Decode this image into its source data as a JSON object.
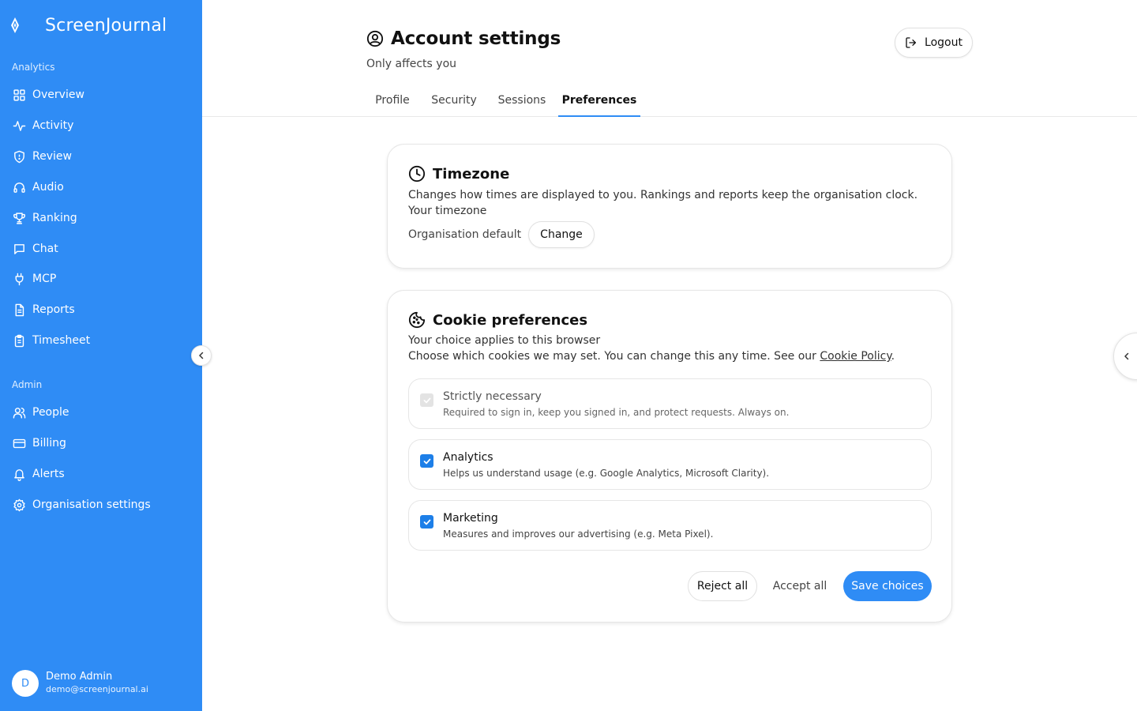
{
  "brand": {
    "name": "ScreenJournal"
  },
  "sidebar": {
    "analytics_label": "Analytics",
    "analytics_items": [
      {
        "label": "Overview",
        "icon": "grid-icon"
      },
      {
        "label": "Activity",
        "icon": "activity-icon"
      },
      {
        "label": "Review",
        "icon": "shield-icon"
      },
      {
        "label": "Audio",
        "icon": "headphones-icon"
      },
      {
        "label": "Ranking",
        "icon": "trophy-icon"
      },
      {
        "label": "Chat",
        "icon": "chat-icon"
      },
      {
        "label": "MCP",
        "icon": "plug-icon"
      },
      {
        "label": "Reports",
        "icon": "document-icon"
      },
      {
        "label": "Timesheet",
        "icon": "clipboard-icon"
      }
    ],
    "admin_label": "Admin",
    "admin_items": [
      {
        "label": "People",
        "icon": "people-icon"
      },
      {
        "label": "Billing",
        "icon": "credit-card-icon"
      },
      {
        "label": "Alerts",
        "icon": "bell-icon"
      },
      {
        "label": "Organisation settings",
        "icon": "gear-icon"
      }
    ],
    "user": {
      "initial": "D",
      "name": "Demo Admin",
      "email": "demo@screenjournal.ai"
    }
  },
  "header": {
    "title": "Account settings",
    "subtitle": "Only affects you",
    "logout_label": "Logout"
  },
  "tabs": [
    {
      "label": "Profile",
      "active": false
    },
    {
      "label": "Security",
      "active": false
    },
    {
      "label": "Sessions",
      "active": false
    },
    {
      "label": "Preferences",
      "active": true
    }
  ],
  "timezone": {
    "title": "Timezone",
    "description": "Changes how times are displayed to you. Rankings and reports keep the organisation clock.",
    "field_label": "Your timezone",
    "current_value": "Organisation default",
    "change_label": "Change"
  },
  "cookies": {
    "title": "Cookie preferences",
    "subtitle": "Your choice applies to this browser",
    "description_prefix": "Choose which cookies we may set. You can change this any time. See our ",
    "policy_link": "Cookie Policy",
    "description_suffix": ".",
    "options": [
      {
        "title": "Strictly necessary",
        "description": "Required to sign in, keep you signed in, and protect requests. Always on.",
        "checked": true,
        "disabled": true
      },
      {
        "title": "Analytics",
        "description": "Helps us understand usage (e.g. Google Analytics, Microsoft Clarity).",
        "checked": true,
        "disabled": false
      },
      {
        "title": "Marketing",
        "description": "Measures and improves our advertising (e.g. Meta Pixel).",
        "checked": true,
        "disabled": false
      }
    ],
    "reject_label": "Reject all",
    "accept_label": "Accept all",
    "save_label": "Save choices"
  },
  "colors": {
    "sidebar": "#2f8cf5",
    "accent": "#2f8cf5",
    "checkbox": "#1d7fe8"
  }
}
